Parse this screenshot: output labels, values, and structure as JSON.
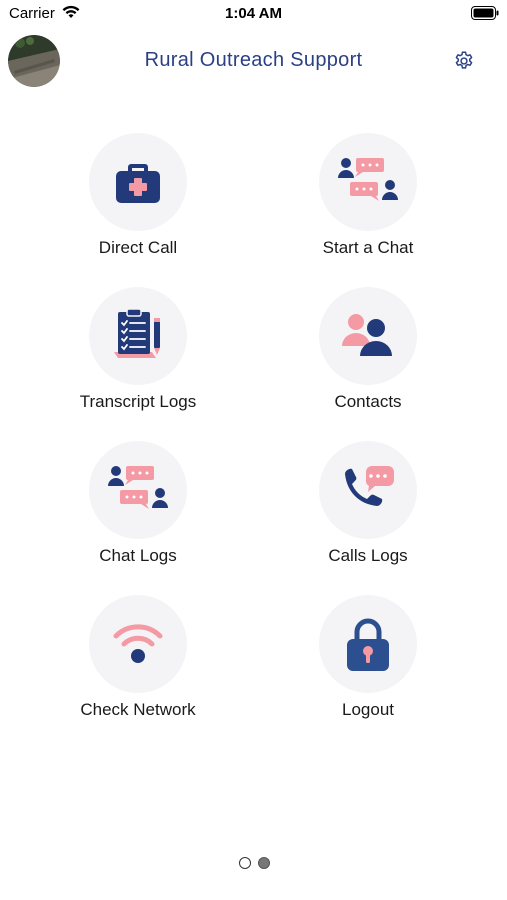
{
  "status_bar": {
    "carrier": "Carrier",
    "time": "1:04 AM"
  },
  "header": {
    "title": "Rural Outreach Support"
  },
  "tiles": [
    {
      "label": "Direct Call",
      "icon": "medical-kit-icon"
    },
    {
      "label": "Start a Chat",
      "icon": "chat-people-icon"
    },
    {
      "label": "Transcript Logs",
      "icon": "clipboard-checklist-icon"
    },
    {
      "label": "Contacts",
      "icon": "contacts-people-icon"
    },
    {
      "label": "Chat Logs",
      "icon": "chat-people-icon"
    },
    {
      "label": "Calls Logs",
      "icon": "phone-chat-icon"
    },
    {
      "label": "Check Network",
      "icon": "wifi-signal-icon"
    },
    {
      "label": "Logout",
      "icon": "padlock-icon"
    }
  ],
  "pager": {
    "pages": 2,
    "current": 2
  },
  "colors": {
    "navy": "#223a7a",
    "pink": "#f49aa4",
    "title": "#2b3f86",
    "circle_bg": "#f4f4f6"
  }
}
